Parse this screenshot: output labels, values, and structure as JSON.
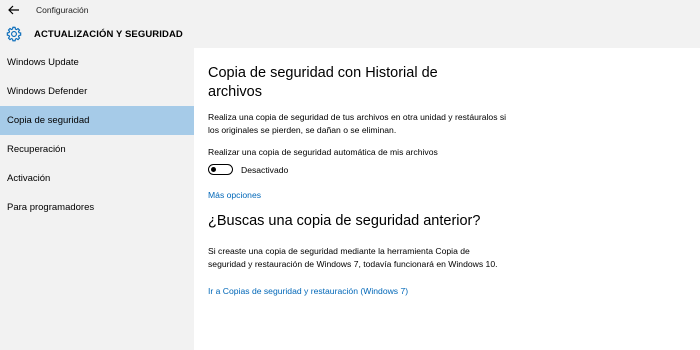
{
  "window": {
    "title": "Configuración"
  },
  "header": {
    "title": "ACTUALIZACIÓN Y SEGURIDAD"
  },
  "sidebar": {
    "items": [
      {
        "label": "Windows Update",
        "selected": false
      },
      {
        "label": "Windows Defender",
        "selected": false
      },
      {
        "label": "Copia de seguridad",
        "selected": true
      },
      {
        "label": "Recuperación",
        "selected": false
      },
      {
        "label": "Activación",
        "selected": false
      },
      {
        "label": "Para programadores",
        "selected": false
      }
    ]
  },
  "main": {
    "heading": "Copia de seguridad con Historial de archivos",
    "description": "Realiza una copia de seguridad de tus archivos en otra unidad y restáuralos si los originales se pierden, se dañan o se eliminan.",
    "auto_backup_label": "Realizar una copia de seguridad automática de mis archivos",
    "toggle_state": "Desactivado",
    "more_options_link": "Más opciones",
    "older_heading": "¿Buscas una copia de seguridad anterior?",
    "older_description": "Si creaste una copia de seguridad mediante la herramienta Copia de seguridad y restauración de Windows 7, todavía funcionará en Windows 10.",
    "restore_link": "Ir a Copias de seguridad y restauración (Windows 7)"
  },
  "colors": {
    "accent_link": "#0067b8",
    "selected_nav": "#a6cbe8",
    "chrome_bg": "#f2f2f2"
  },
  "icons": {
    "back": "arrow-left-icon",
    "settings": "gear-icon"
  }
}
